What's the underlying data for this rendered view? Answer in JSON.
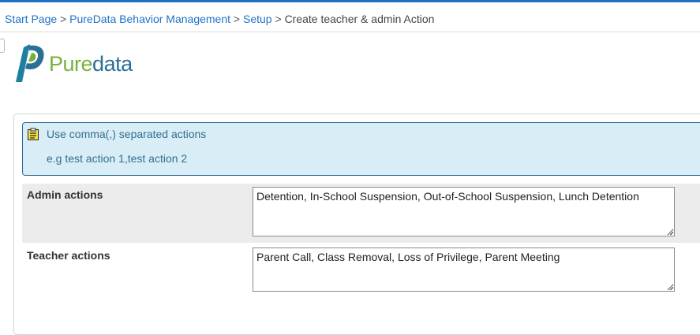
{
  "breadcrumb": {
    "items": [
      "Start Page",
      "PureData Behavior Management",
      "Setup"
    ],
    "separator": ">",
    "current": "Create teacher & admin Action"
  },
  "logo": {
    "pure": "Pure",
    "data": "data"
  },
  "info": {
    "icon": "clipboard-icon",
    "line1": "Use comma(,) separated actions",
    "line2": "e.g test action 1,test action 2"
  },
  "form": {
    "admin": {
      "label": "Admin actions",
      "value": "Detention, In-School Suspension, Out-of-School Suspension, Lunch Detention"
    },
    "teacher": {
      "label": "Teacher actions",
      "value": "Parent Call, Class Removal, Loss of Privilege, Parent Meeting"
    }
  },
  "colors": {
    "accent": "#1f6fc5",
    "link": "#1f72c8",
    "info_bg": "#d9edf7",
    "info_text": "#31708f",
    "logo_green": "#74b23a",
    "logo_blue": "#2c6f95"
  }
}
